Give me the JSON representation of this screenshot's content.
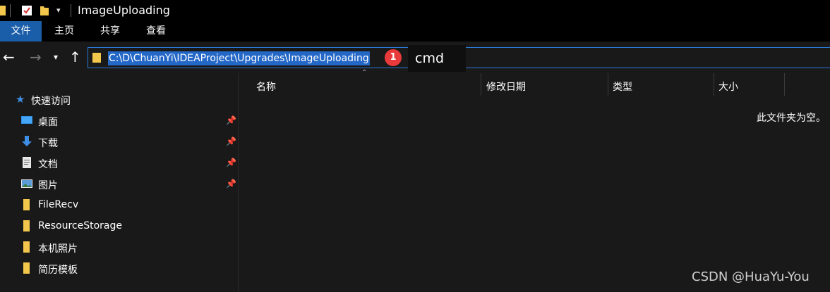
{
  "window": {
    "title": "ImageUploading"
  },
  "ribbon": {
    "tabs": [
      "文件",
      "主页",
      "共享",
      "查看"
    ]
  },
  "address": {
    "path": "C:\\D\\ChuanYi\\IDEAProject\\Upgrades\\ImageUploading",
    "badge": "1",
    "tooltip": "cmd"
  },
  "sidebar": {
    "quick_access": "快速访问",
    "items": [
      "桌面",
      "下载",
      "文档",
      "图片",
      "FileRecv",
      "ResourceStorage",
      "本机照片",
      "简历模板"
    ]
  },
  "columns": [
    "名称",
    "修改日期",
    "类型",
    "大小"
  ],
  "content": {
    "empty_message": "此文件夹为空。"
  },
  "watermark": "CSDN @HuaYu-You",
  "colors": {
    "accent": "#1a5da8",
    "selection": "#2367c7",
    "badge": "#e83a3a",
    "background": "#191919"
  }
}
